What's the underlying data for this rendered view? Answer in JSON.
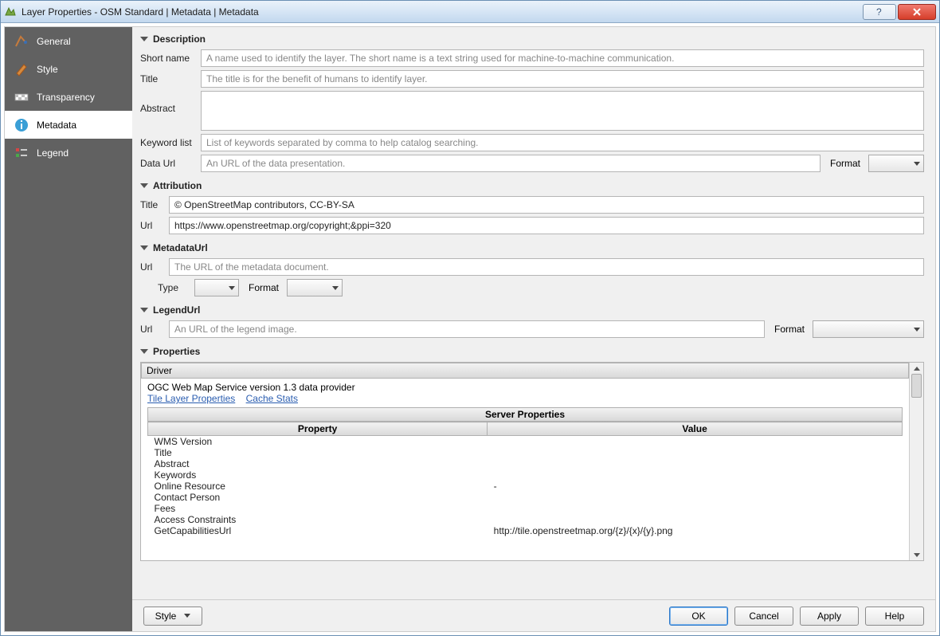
{
  "window": {
    "title": "Layer Properties - OSM Standard | Metadata | Metadata"
  },
  "sidebar": {
    "items": [
      {
        "label": "General"
      },
      {
        "label": "Style"
      },
      {
        "label": "Transparency"
      },
      {
        "label": "Metadata"
      },
      {
        "label": "Legend"
      }
    ]
  },
  "sections": {
    "description": {
      "title": "Description",
      "short_name_label": "Short name",
      "short_name_ph": "A name used to identify the layer. The short name is a text string used for machine-to-machine communication.",
      "title_label": "Title",
      "title_ph": "The title is for the benefit of humans to identify layer.",
      "abstract_label": "Abstract",
      "keywords_label": "Keyword list",
      "keywords_ph": "List of keywords separated by comma to help catalog searching.",
      "dataurl_label": "Data Url",
      "dataurl_ph": "An URL of the data presentation.",
      "format_label": "Format"
    },
    "attribution": {
      "title": "Attribution",
      "title_label": "Title",
      "title_value": "© OpenStreetMap contributors, CC-BY-SA",
      "url_label": "Url",
      "url_value": "https://www.openstreetmap.org/copyright;&ppi=320"
    },
    "metadataurl": {
      "title": "MetadataUrl",
      "url_label": "Url",
      "url_ph": "The URL of the metadata document.",
      "type_label": "Type",
      "format_label": "Format"
    },
    "legendurl": {
      "title": "LegendUrl",
      "url_label": "Url",
      "url_ph": "An URL of the legend image.",
      "format_label": "Format"
    },
    "properties": {
      "title": "Properties",
      "driver_label": "Driver",
      "provider_text": "OGC Web Map Service version 1.3 data provider",
      "link_tile": "Tile Layer Properties",
      "link_cache": "Cache Stats",
      "server_props_heading": "Server Properties",
      "col_property": "Property",
      "col_value": "Value",
      "rows": [
        {
          "p": "WMS Version",
          "v": ""
        },
        {
          "p": "Title",
          "v": ""
        },
        {
          "p": "Abstract",
          "v": ""
        },
        {
          "p": "Keywords",
          "v": ""
        },
        {
          "p": "Online Resource",
          "v": "-"
        },
        {
          "p": "Contact Person",
          "v": ""
        },
        {
          "p": "",
          "v": ""
        },
        {
          "p": "Fees",
          "v": ""
        },
        {
          "p": "Access Constraints",
          "v": ""
        },
        {
          "p": "GetCapabilitiesUrl",
          "v": "http://tile.openstreetmap.org/{z}/{x}/{y}.png"
        }
      ]
    }
  },
  "footer": {
    "style": "Style",
    "ok": "OK",
    "cancel": "Cancel",
    "apply": "Apply",
    "help": "Help"
  }
}
